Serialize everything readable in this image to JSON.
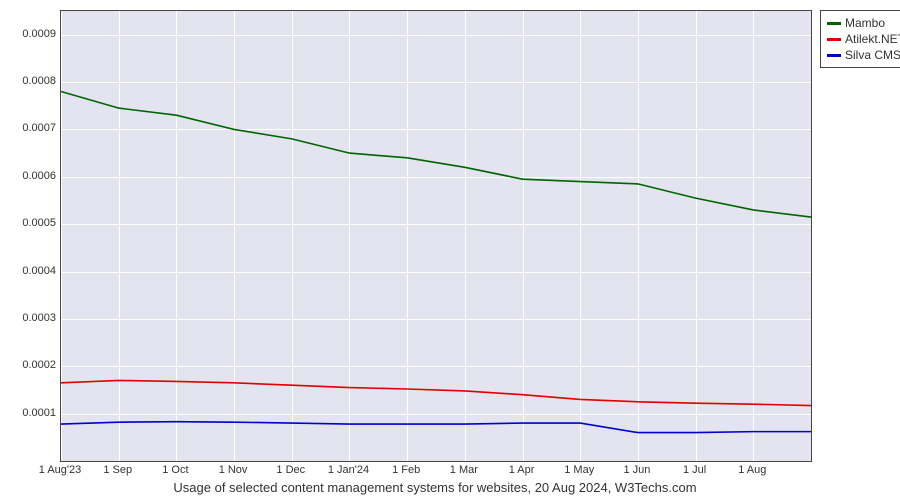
{
  "chart_data": {
    "type": "line",
    "title": "",
    "caption": "Usage of selected content management systems for websites, 20 Aug 2024, W3Techs.com",
    "xlabel": "",
    "ylabel": "",
    "ylim": [
      0,
      0.00095
    ],
    "y_ticks": [
      0.0001,
      0.0002,
      0.0003,
      0.0004,
      0.0005,
      0.0006,
      0.0007,
      0.0008,
      0.0009
    ],
    "x_categories": [
      "1 Aug'23",
      "1 Sep",
      "1 Oct",
      "1 Nov",
      "1 Dec",
      "1 Jan'24",
      "1 Feb",
      "1 Mar",
      "1 Apr",
      "1 May",
      "1 Jun",
      "1 Jul",
      "1 Aug"
    ],
    "series": [
      {
        "name": "Mambo",
        "color": "#006400",
        "values": [
          0.00078,
          0.000745,
          0.00073,
          0.0007,
          0.00068,
          0.00065,
          0.00064,
          0.00062,
          0.000595,
          0.00059,
          0.000585,
          0.000555,
          0.00053,
          0.000515
        ]
      },
      {
        "name": "Atilekt.NET",
        "color": "#e00000",
        "values": [
          0.000165,
          0.00017,
          0.000168,
          0.000165,
          0.00016,
          0.000155,
          0.000152,
          0.000148,
          0.00014,
          0.00013,
          0.000125,
          0.000122,
          0.00012,
          0.000117
        ]
      },
      {
        "name": "Silva CMS",
        "color": "#0000d0",
        "values": [
          7.8e-05,
          8.2e-05,
          8.3e-05,
          8.2e-05,
          8e-05,
          7.8e-05,
          7.8e-05,
          7.8e-05,
          8e-05,
          8e-05,
          6e-05,
          6e-05,
          6.2e-05,
          6.2e-05
        ]
      }
    ],
    "n_points": 14
  }
}
